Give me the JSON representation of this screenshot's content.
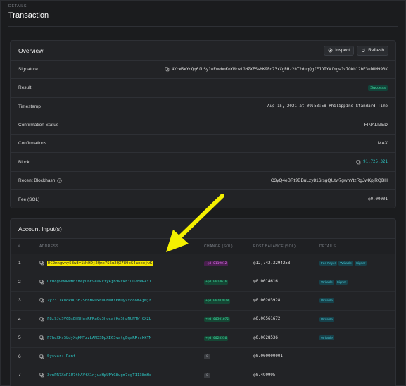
{
  "header": {
    "eyebrow": "DETAILS",
    "title": "Transaction"
  },
  "overview": {
    "title": "Overview",
    "inspect_label": "Inspect",
    "refresh_label": "Refresh",
    "rows": [
      {
        "label": "Signature",
        "value": "4YcWSWYcQq6fUSy1wFmwbmKoYMrwiGHZXFSsMK9Po73xXgRHz2hT2duqQgfEJDTYXfngwJv7Okb12bE3uDUM993K",
        "kind": "copy"
      },
      {
        "label": "Result",
        "value": "Success",
        "kind": "badge"
      },
      {
        "label": "Timestamp",
        "value": "Aug 15, 2021 at 09:53:58 Philippine Standard Time",
        "kind": "mono"
      },
      {
        "label": "Confirmation Status",
        "value": "FINALIZED",
        "kind": "sans"
      },
      {
        "label": "Confirmations",
        "value": "MAX",
        "kind": "sans"
      },
      {
        "label": "Block",
        "value": "91,725,321",
        "kind": "copylink"
      },
      {
        "label": "Recent Blockhash",
        "value": "C3yQ4eBRt9BBuLzy816rsgQUtw7gwhYtzRgJwKpjRQBH",
        "kind": "sans",
        "help": true
      },
      {
        "label": "Fee (SOL)",
        "value": "◎0.00001",
        "kind": "mono"
      }
    ]
  },
  "accounts": {
    "title": "Account Input(s)",
    "columns": [
      "#",
      "ADDRESS",
      "CHANGE (SOL)",
      "POST BALANCE (SOL)",
      "DETAILS"
    ],
    "rows": [
      {
        "num": "1",
        "address": "DC2mkgwhy58w3v1NtHDj2Qmc7S6u2QX789bS4aexojwK",
        "highlight": true,
        "change": "-◎0.0119012",
        "change_kind": "neg",
        "post": "◎12,742.3294258",
        "tags": [
          "Fee Payer",
          "Writable",
          "Signer"
        ]
      },
      {
        "num": "2",
        "address": "DrUcgvMwRWHhYMeyL6FveaRciyAjbYPckEiuQZEWPAY1",
        "change": "+◎0.0014616",
        "change_kind": "pos",
        "post": "◎0.0014616",
        "tags": [
          "Writable",
          "Signer"
        ]
      },
      {
        "num": "3",
        "address": "Zy2311kdoPDQ3E7ShhHPUxnUGHUWY6KQyVxcoVm4jMjr",
        "change": "+◎0.00203928",
        "change_kind": "pos",
        "post": "◎0.00203928",
        "tags": [
          "Writable"
        ]
      },
      {
        "num": "4",
        "address": "F8z9JoSV6BsBH9HnrRPRaQc3hocafKaShpNUNTWjCX2L",
        "change": "+◎0.00561672",
        "change_kind": "pos",
        "post": "◎0.00561672",
        "tags": [
          "Writable"
        ]
      },
      {
        "num": "5",
        "address": "F7huXKsSLdyXqKMTzzLAM3SDpXE63vatgBqaRRrskkTM",
        "change": "+◎0.0028536",
        "change_kind": "pos",
        "post": "◎0.0028536",
        "tags": [
          "Writable"
        ]
      },
      {
        "num": "6",
        "address": "Sysvar: Rent",
        "change": "0",
        "change_kind": "zero",
        "post": "◎0.000000001",
        "tags": []
      },
      {
        "num": "7",
        "address": "3vnPR7XoR1U7tkAVfX1njuaHpUPYG8ugm7cgT1138mHc",
        "change": "0",
        "change_kind": "zero",
        "post": "◎0.499995",
        "tags": []
      }
    ]
  },
  "colors": {
    "accent": "#2cc6c3",
    "highlight": "#f4e600",
    "success": "#3fdc9f",
    "negative": "#e36ef0"
  }
}
